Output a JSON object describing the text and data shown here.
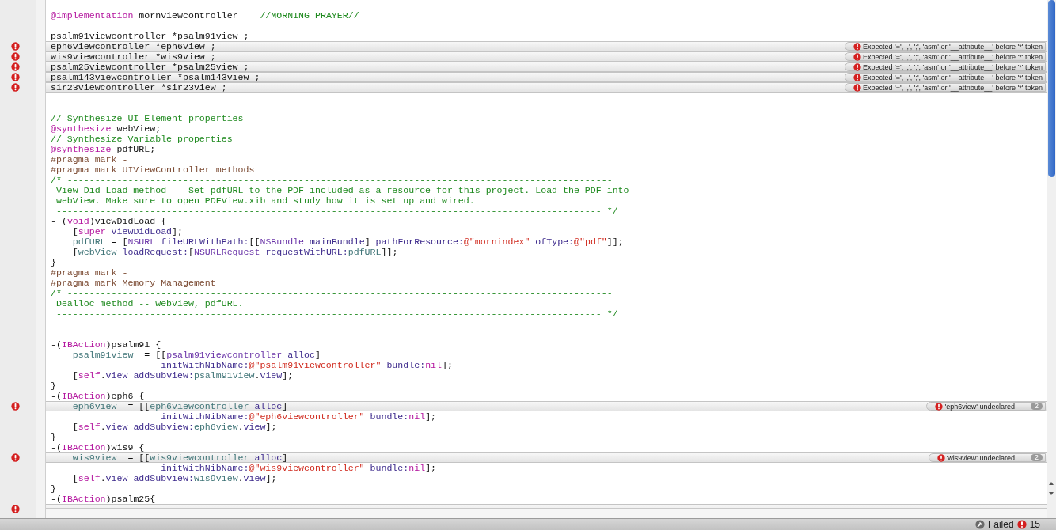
{
  "editor": {
    "lines": [
      {
        "error": false
      },
      {
        "error": false,
        "tokens": [
          {
            "kind": "kw",
            "text": "@implementation"
          },
          {
            "kind": "plain",
            "text": " mornviewcontroller    "
          },
          {
            "kind": "comment",
            "text": "//MORNING PRAYER//"
          }
        ]
      },
      {
        "error": false
      },
      {
        "error": false,
        "tokens": [
          {
            "kind": "plain",
            "text": "psalm91viewcontroller *psalm91view ;"
          }
        ]
      },
      {
        "error": true,
        "message": "Expected '=', ',', ';', 'asm' or '__attribute__' before '*' token",
        "tokens": [
          {
            "kind": "plain",
            "text": "eph6viewcontroller *eph6view ;"
          }
        ]
      },
      {
        "error": true,
        "message": "Expected '=', ',', ';', 'asm' or '__attribute__' before '*' token",
        "tokens": [
          {
            "kind": "plain",
            "text": "wis9viewcontroller *wis9view ;"
          }
        ]
      },
      {
        "error": true,
        "message": "Expected '=', ',', ';', 'asm' or '__attribute__' before '*' token",
        "tokens": [
          {
            "kind": "plain",
            "text": "psalm25viewcontroller *psalm25view ;"
          }
        ]
      },
      {
        "error": true,
        "message": "Expected '=', ',', ';', 'asm' or '__attribute__' before '*' token",
        "tokens": [
          {
            "kind": "plain",
            "text": "psalm143viewcontroller *psalm143view ;"
          }
        ]
      },
      {
        "error": true,
        "message": "Expected '=', ',', ';', 'asm' or '__attribute__' before '*' token",
        "tokens": [
          {
            "kind": "plain",
            "text": "sir23viewcontroller *sir23view ;"
          }
        ]
      },
      {
        "error": false
      },
      {
        "error": false
      },
      {
        "error": false,
        "tokens": [
          {
            "kind": "comment",
            "text": "// Synthesize UI Element properties"
          }
        ]
      },
      {
        "error": false,
        "tokens": [
          {
            "kind": "kw",
            "text": "@synthesize"
          },
          {
            "kind": "plain",
            "text": " webView;"
          }
        ]
      },
      {
        "error": false,
        "tokens": [
          {
            "kind": "comment",
            "text": "// Synthesize Variable properties"
          }
        ]
      },
      {
        "error": false,
        "tokens": [
          {
            "kind": "kw",
            "text": "@synthesize"
          },
          {
            "kind": "plain",
            "text": " pdfURL;"
          }
        ]
      },
      {
        "error": false,
        "tokens": [
          {
            "kind": "pragma",
            "text": "#pragma mark -"
          }
        ]
      },
      {
        "error": false,
        "tokens": [
          {
            "kind": "pragma",
            "text": "#pragma mark UIViewController methods"
          }
        ]
      },
      {
        "error": false,
        "tokens": [
          {
            "kind": "comment",
            "text": "/* ---------------------------------------------------------------------------------------------------"
          }
        ]
      },
      {
        "error": false,
        "tokens": [
          {
            "kind": "comment",
            "text": " View Did Load method -- Set pdfURL to the PDF included as a resource for this project. Load the PDF into"
          }
        ]
      },
      {
        "error": false,
        "tokens": [
          {
            "kind": "comment",
            "text": " webView. Make sure to open PDFView.xib and study how it is set up and wired."
          }
        ]
      },
      {
        "error": false,
        "tokens": [
          {
            "kind": "comment",
            "text": " --------------------------------------------------------------------------------------------------- */"
          }
        ]
      },
      {
        "error": false,
        "tokens": [
          {
            "kind": "plain",
            "text": "- ("
          },
          {
            "kind": "kw",
            "text": "void"
          },
          {
            "kind": "plain",
            "text": ")viewDidLoad {"
          }
        ]
      },
      {
        "error": false,
        "tokens": [
          {
            "kind": "plain",
            "text": "    ["
          },
          {
            "kind": "kw",
            "text": "super"
          },
          {
            "kind": "method",
            "text": " viewDidLoad"
          },
          {
            "kind": "plain",
            "text": "];"
          }
        ]
      },
      {
        "error": false,
        "tokens": [
          {
            "kind": "ivar",
            "text": "    pdfURL"
          },
          {
            "kind": "plain",
            "text": " = ["
          },
          {
            "kind": "cls",
            "text": "NSURL"
          },
          {
            "kind": "method",
            "text": " fileURLWithPath:"
          },
          {
            "kind": "plain",
            "text": "[["
          },
          {
            "kind": "cls",
            "text": "NSBundle"
          },
          {
            "kind": "method",
            "text": " mainBundle"
          },
          {
            "kind": "plain",
            "text": "] "
          },
          {
            "kind": "method",
            "text": "pathForResource:"
          },
          {
            "kind": "str",
            "text": "@\"mornindex\""
          },
          {
            "kind": "method",
            "text": " ofType:"
          },
          {
            "kind": "str",
            "text": "@\"pdf\""
          },
          {
            "kind": "plain",
            "text": "]];"
          }
        ]
      },
      {
        "error": false,
        "tokens": [
          {
            "kind": "plain",
            "text": "    ["
          },
          {
            "kind": "ivar",
            "text": "webView"
          },
          {
            "kind": "method",
            "text": " loadRequest:"
          },
          {
            "kind": "plain",
            "text": "["
          },
          {
            "kind": "cls",
            "text": "NSURLRequest"
          },
          {
            "kind": "method",
            "text": " requestWithURL:"
          },
          {
            "kind": "ivar",
            "text": "pdfURL"
          },
          {
            "kind": "plain",
            "text": "]];"
          }
        ]
      },
      {
        "error": false,
        "tokens": [
          {
            "kind": "plain",
            "text": "}"
          }
        ]
      },
      {
        "error": false,
        "tokens": [
          {
            "kind": "pragma",
            "text": "#pragma mark -"
          }
        ]
      },
      {
        "error": false,
        "tokens": [
          {
            "kind": "pragma",
            "text": "#pragma mark Memory Management"
          }
        ]
      },
      {
        "error": false,
        "tokens": [
          {
            "kind": "comment",
            "text": "/* ---------------------------------------------------------------------------------------------------"
          }
        ]
      },
      {
        "error": false,
        "tokens": [
          {
            "kind": "comment",
            "text": " Dealloc method -- webView, pdfURL."
          }
        ]
      },
      {
        "error": false,
        "tokens": [
          {
            "kind": "comment",
            "text": " --------------------------------------------------------------------------------------------------- */"
          }
        ]
      },
      {
        "error": false
      },
      {
        "error": false
      },
      {
        "error": false,
        "tokens": [
          {
            "kind": "plain",
            "text": "-("
          },
          {
            "kind": "kw",
            "text": "IBAction"
          },
          {
            "kind": "plain",
            "text": ")psalm91 {"
          }
        ]
      },
      {
        "error": false,
        "tokens": [
          {
            "kind": "ivar",
            "text": "    psalm91view"
          },
          {
            "kind": "plain",
            "text": "  = [["
          },
          {
            "kind": "cls",
            "text": "psalm91viewcontroller"
          },
          {
            "kind": "method",
            "text": " alloc"
          },
          {
            "kind": "plain",
            "text": "]"
          }
        ]
      },
      {
        "error": false,
        "tokens": [
          {
            "kind": "method",
            "text": "                    initWithNibName:"
          },
          {
            "kind": "str",
            "text": "@\"psalm91viewcontroller\""
          },
          {
            "kind": "method",
            "text": " bundle:"
          },
          {
            "kind": "kw",
            "text": "nil"
          },
          {
            "kind": "plain",
            "text": "];"
          }
        ]
      },
      {
        "error": false,
        "tokens": [
          {
            "kind": "plain",
            "text": "    ["
          },
          {
            "kind": "kw",
            "text": "self"
          },
          {
            "kind": "plain",
            "text": "."
          },
          {
            "kind": "method",
            "text": "view addSubview:"
          },
          {
            "kind": "ivar",
            "text": "psalm91view"
          },
          {
            "kind": "plain",
            "text": "."
          },
          {
            "kind": "method",
            "text": "view"
          },
          {
            "kind": "plain",
            "text": "];"
          }
        ]
      },
      {
        "error": false,
        "tokens": [
          {
            "kind": "plain",
            "text": "}"
          }
        ]
      },
      {
        "error": false,
        "tokens": [
          {
            "kind": "plain",
            "text": "-("
          },
          {
            "kind": "kw",
            "text": "IBAction"
          },
          {
            "kind": "plain",
            "text": ")eph6 {"
          }
        ]
      },
      {
        "error": true,
        "message": "'eph6view' undeclared",
        "count": "2",
        "tokens": [
          {
            "kind": "ivar",
            "text": "    eph6view"
          },
          {
            "kind": "plain",
            "text": "  = [["
          },
          {
            "kind": "ivar",
            "text": "eph6viewcontroller"
          },
          {
            "kind": "method",
            "text": " alloc"
          },
          {
            "kind": "plain",
            "text": "]"
          }
        ]
      },
      {
        "error": false,
        "tokens": [
          {
            "kind": "method",
            "text": "                    initWithNibName:"
          },
          {
            "kind": "str",
            "text": "@\"eph6viewcontroller\""
          },
          {
            "kind": "method",
            "text": " bundle:"
          },
          {
            "kind": "kw",
            "text": "nil"
          },
          {
            "kind": "plain",
            "text": "];"
          }
        ]
      },
      {
        "error": false,
        "tokens": [
          {
            "kind": "plain",
            "text": "    ["
          },
          {
            "kind": "kw",
            "text": "self"
          },
          {
            "kind": "plain",
            "text": "."
          },
          {
            "kind": "method",
            "text": "view addSubview:"
          },
          {
            "kind": "ivar",
            "text": "eph6view"
          },
          {
            "kind": "plain",
            "text": "."
          },
          {
            "kind": "method",
            "text": "view"
          },
          {
            "kind": "plain",
            "text": "];"
          }
        ]
      },
      {
        "error": false,
        "tokens": [
          {
            "kind": "plain",
            "text": "}"
          }
        ]
      },
      {
        "error": false,
        "tokens": [
          {
            "kind": "plain",
            "text": "-("
          },
          {
            "kind": "kw",
            "text": "IBAction"
          },
          {
            "kind": "plain",
            "text": ")wis9 {"
          }
        ]
      },
      {
        "error": true,
        "message": "'wis9view' undeclared",
        "count": "2",
        "tokens": [
          {
            "kind": "ivar",
            "text": "    wis9view"
          },
          {
            "kind": "plain",
            "text": "  = [["
          },
          {
            "kind": "ivar",
            "text": "wis9viewcontroller"
          },
          {
            "kind": "method",
            "text": " alloc"
          },
          {
            "kind": "plain",
            "text": "]"
          }
        ]
      },
      {
        "error": false,
        "tokens": [
          {
            "kind": "method",
            "text": "                    initWithNibName:"
          },
          {
            "kind": "str",
            "text": "@\"wis9viewcontroller\""
          },
          {
            "kind": "method",
            "text": " bundle:"
          },
          {
            "kind": "kw",
            "text": "nil"
          },
          {
            "kind": "plain",
            "text": "];"
          }
        ]
      },
      {
        "error": false,
        "tokens": [
          {
            "kind": "plain",
            "text": "    ["
          },
          {
            "kind": "kw",
            "text": "self"
          },
          {
            "kind": "plain",
            "text": "."
          },
          {
            "kind": "method",
            "text": "view addSubview:"
          },
          {
            "kind": "ivar",
            "text": "wis9view"
          },
          {
            "kind": "plain",
            "text": "."
          },
          {
            "kind": "method",
            "text": "view"
          },
          {
            "kind": "plain",
            "text": "];"
          }
        ]
      },
      {
        "error": false,
        "tokens": [
          {
            "kind": "plain",
            "text": "}"
          }
        ]
      },
      {
        "error": false,
        "tokens": [
          {
            "kind": "plain",
            "text": "-("
          },
          {
            "kind": "kw",
            "text": "IBAction"
          },
          {
            "kind": "plain",
            "text": ")psalm25{"
          }
        ]
      },
      {
        "error": true
      }
    ]
  },
  "status_bar": {
    "build_status": "Failed",
    "error_count": "15"
  }
}
